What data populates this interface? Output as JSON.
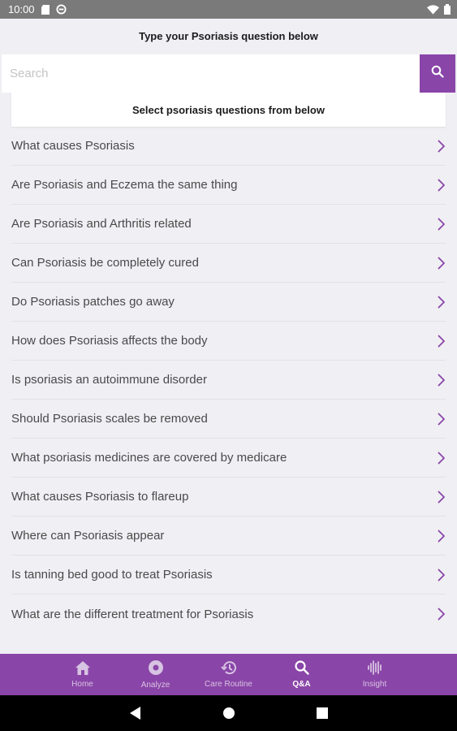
{
  "status_bar": {
    "time": "10:00",
    "icons_left": [
      "sd-card-icon",
      "sync-icon"
    ],
    "icons_right": [
      "wifi-icon",
      "battery-icon"
    ]
  },
  "prompt": {
    "text": "Type your Psoriasis question below"
  },
  "search": {
    "placeholder": "Search",
    "value": ""
  },
  "select_header": {
    "text": "Select psoriasis questions from below"
  },
  "questions": [
    "What causes Psoriasis",
    "Are Psoriasis and Eczema the same thing",
    "Are Psoriasis and Arthritis related",
    "Can Psoriasis be completely cured",
    "Do Psoriasis patches go away",
    "How does Psoriasis affects the body",
    "Is psoriasis an autoimmune disorder",
    "Should Psoriasis scales be removed",
    "What psoriasis medicines are covered by medicare",
    "What causes Psoriasis to flareup",
    "Where can Psoriasis appear",
    "Is tanning bed good to treat Psoriasis",
    "What are the different treatment for Psoriasis"
  ],
  "bottom_nav": {
    "items": [
      {
        "label": "Home",
        "icon": "home-icon",
        "active": false
      },
      {
        "label": "Analyze",
        "icon": "analyze-icon",
        "active": false
      },
      {
        "label": "Care Routine",
        "icon": "history-icon",
        "active": false
      },
      {
        "label": "Q&A",
        "icon": "search-icon",
        "active": true
      },
      {
        "label": "Insight",
        "icon": "waveform-icon",
        "active": false
      }
    ]
  },
  "colors": {
    "accent": "#8a45a8",
    "background": "#efeff4",
    "status_bar": "#7a7a7a",
    "chevron": "#8a45a8"
  }
}
